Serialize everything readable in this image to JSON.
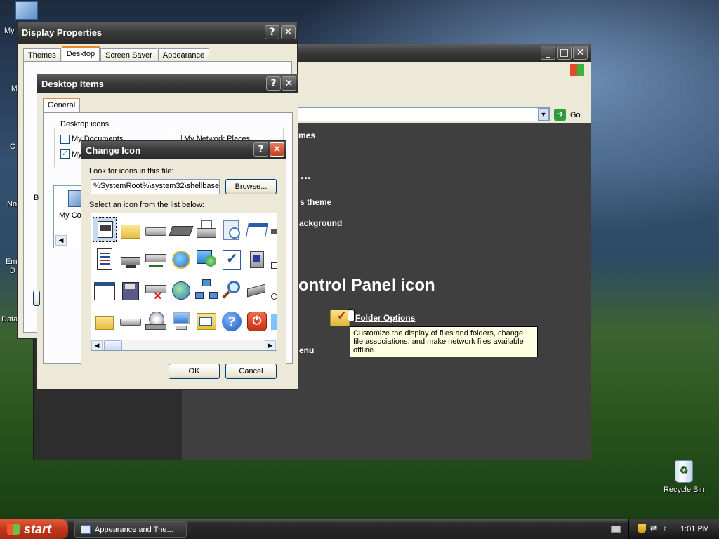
{
  "desktop": {
    "labels": [
      "My",
      "M",
      "C",
      "No",
      "Em",
      "D",
      "Data"
    ],
    "recycle_bin": "Recycle Bin"
  },
  "control_panel": {
    "go_label": "Go",
    "heading_fragment": "ontrol Panel icon",
    "items": [
      "mes",
      "...",
      "s theme",
      "ackground",
      "Folder Options",
      "enu"
    ],
    "tooltip": "Customize the display of files and folders, change file associations, and make network files available offline."
  },
  "display_properties": {
    "title": "Display Properties",
    "tabs": [
      "Themes",
      "Desktop",
      "Screen Saver",
      "Appearance"
    ]
  },
  "desktop_items": {
    "title": "Desktop Items",
    "tab": "General",
    "group": "Desktop icons",
    "checks": [
      {
        "label": "My Documents",
        "checked": false
      },
      {
        "label": "My Network Places",
        "checked": false
      },
      {
        "label": "My",
        "checked": true
      }
    ],
    "preview_label": "My Co",
    "side_label": "B"
  },
  "change_icon": {
    "title": "Change Icon",
    "look_label": "Look for icons in this file:",
    "file_value": "%SystemRoot%\\system32\\shellbase",
    "browse_label": "Browse...",
    "select_label": "Select an icon from the list below:",
    "ok_label": "OK",
    "cancel_label": "Cancel"
  },
  "taskbar": {
    "start_label": "start",
    "task_label": "Appearance and The...",
    "clock": "1:01 PM"
  },
  "window_controls": {
    "help": "?",
    "close": "✕",
    "minimize": "_",
    "maximize": "□"
  }
}
